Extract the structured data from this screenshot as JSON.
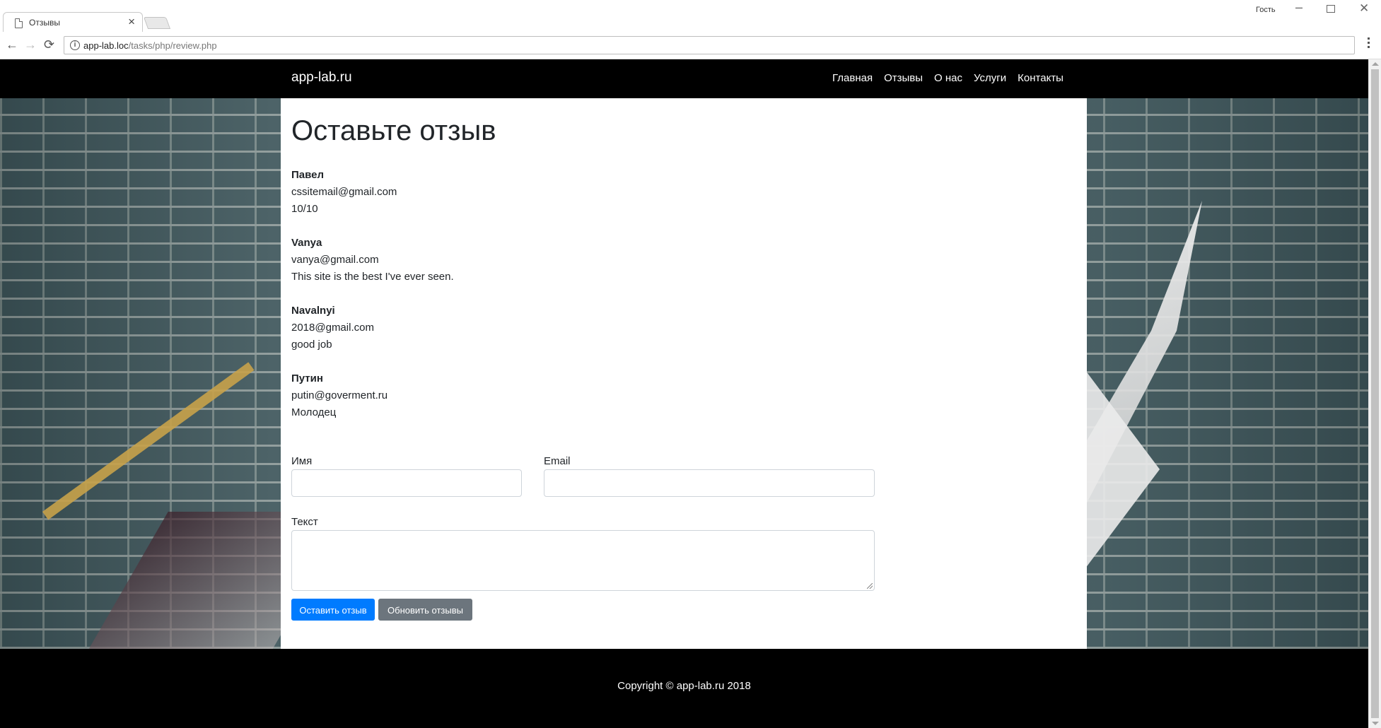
{
  "browser": {
    "tab_title": "Отзывы",
    "tab_close": "×",
    "profile": "Гость",
    "url_host": "app-lab.loc",
    "url_path": "/tasks/php/review.php",
    "back": "←",
    "forward": "→",
    "reload": "⟳",
    "min": "–",
    "close": "✕"
  },
  "site": {
    "brand": "app-lab.ru",
    "nav": [
      {
        "label": "Главная"
      },
      {
        "label": "Отзывы"
      },
      {
        "label": "О нас"
      },
      {
        "label": "Услуги"
      },
      {
        "label": "Контакты"
      }
    ]
  },
  "main": {
    "title": "Оставьте отзыв",
    "reviews": [
      {
        "name": "Павел",
        "email": "cssitemail@gmail.com",
        "text": "10/10"
      },
      {
        "name": "Vanya",
        "email": "vanya@gmail.com",
        "text": "This site is the best I've ever seen."
      },
      {
        "name": "Navalnyi",
        "email": "2018@gmail.com",
        "text": "good job"
      },
      {
        "name": "Путин",
        "email": "putin@goverment.ru",
        "text": "Молодец"
      }
    ],
    "form": {
      "name_label": "Имя",
      "name_value": "",
      "email_label": "Email",
      "email_value": "",
      "text_label": "Текст",
      "text_value": "",
      "submit_label": "Оставить отзыв",
      "refresh_label": "Обновить отзывы"
    }
  },
  "footer": {
    "copyright": "Copyright © app-lab.ru 2018"
  },
  "colors": {
    "primary": "#007bff",
    "secondary": "#6c757d",
    "navbar": "#000000"
  }
}
